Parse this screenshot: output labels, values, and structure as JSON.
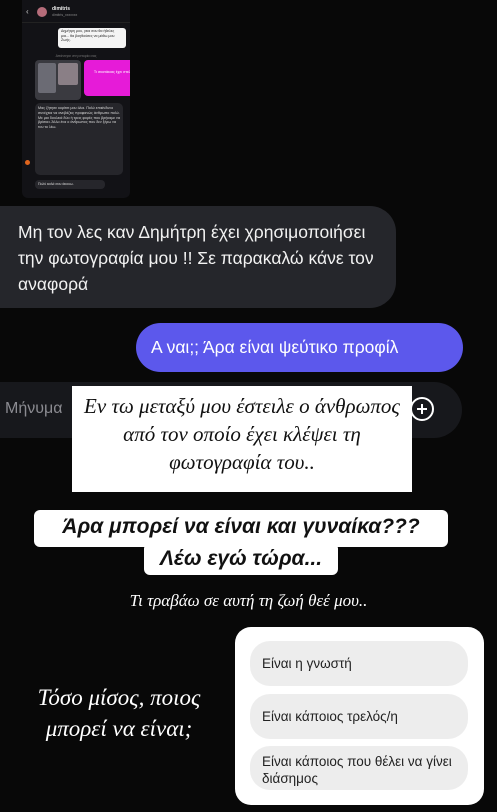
{
  "mini_screenshot": {
    "back": "‹",
    "name": "dimitris",
    "subtitle": "dimitris_xxxxxxx",
    "white_message": "Δημήτρη μου, γεια σου θα ήθελες μια... θα βοηθούσες να μάθω μου Ζωής.",
    "divider": "Απάντησε στη ιστορία σας",
    "pink_message": "Τι σκατάκιας έχει στείλει?",
    "long_message": "Μας ζήτησε κορίτσι μου όλοι. Πολύ επικίνδυνο συνέχεια να ανεβάζεις προφανώς άνθρωπο πολύ. Με μια δουλειά δύο ή τρεις φορές που βρήκαμε να βρίσκει. Άλλο ένα ο άνθρωπος που δεν ξέρω να του το λέω.",
    "footer": "Πολύ καλά σου άκουω."
  },
  "chat": {
    "received_message": "Μη τον λες καν Δημήτρη έχει χρησιμοποιήσει την φωτογραφία μου !! Σε παρακαλώ κάνε τον αναφορά",
    "sent_message": "Α ναι;; Άρα είναι ψεύτικο προφίλ",
    "input_placeholder": "Μήνυμα"
  },
  "story": {
    "caption": "Εν τω μεταξύ μου έστειλε ο άνθρωπος από τον οποίο έχει κλέψει τη φωτογραφία του..",
    "question_line1": "Άρα μπορεί να είναι και γυναίκα???",
    "question_line2": "Λέω εγώ τώρα...",
    "subcaption": "Τι τραβάω σε αυτή τη ζωή θεέ μου..",
    "hate_text": "Τόσο μίσος, ποιος μπορεί να είναι;"
  },
  "poll": {
    "options": [
      {
        "label": "Είναι η γνωστή"
      },
      {
        "label": "Είναι κάποιος τρελός/η"
      },
      {
        "label": "Είναι κάποιος που θέλει να γίνει διάσημος"
      }
    ]
  },
  "colors": {
    "sent_bubble": "#5c58ec",
    "received_bubble": "#25262b",
    "pink_accent": "#e61bd8"
  }
}
